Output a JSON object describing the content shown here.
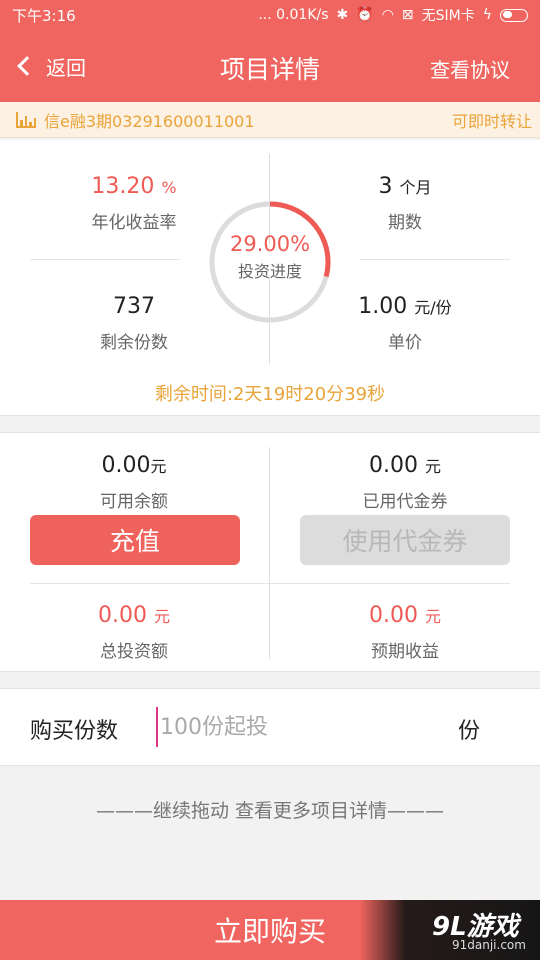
{
  "statusbar": {
    "time": "下午3:16",
    "network": "... 0.01K/s",
    "sim": "无SIM卡"
  },
  "nav": {
    "back_label": "返回",
    "title": "项目详情",
    "right_label": "查看协议"
  },
  "info": {
    "product_code": "信e融3期03291600011001",
    "transfer_status": "可即时转让"
  },
  "stats": {
    "rate_value": "13.20",
    "rate_unit": "%",
    "rate_label": "年化收益率",
    "term_value": "3",
    "term_unit": "个月",
    "term_label": "期数",
    "remaining_value": "737",
    "remaining_label": "剩余份数",
    "price_value": "1.00",
    "price_unit": "元/份",
    "price_label": "单价"
  },
  "progress": {
    "value": 0.29,
    "text": "29.00%",
    "label": "投资进度"
  },
  "countdown": "剩余时间:2天19时20分39秒",
  "account": {
    "balance_value": "0.00",
    "balance_unit": "元",
    "balance_label": "可用余额",
    "voucher_value": "0.00",
    "voucher_unit": "元",
    "voucher_label": "已用代金券",
    "recharge_button": "充值",
    "voucher_button": "使用代金券",
    "total_value": "0.00",
    "total_unit": "元",
    "total_label": "总投资额",
    "expected_value": "0.00",
    "expected_unit": "元",
    "expected_label": "预期收益"
  },
  "purchase": {
    "label": "购买份数",
    "placeholder": "100份起投",
    "unit": "份"
  },
  "more_hint": "———继续拖动 查看更多项目详情———",
  "buy_button": "立即购买",
  "watermark": {
    "logo": "9L游戏",
    "site": "91danji.com"
  },
  "colors": {
    "brand": "#f0655f",
    "accent_orange": "#e9a43a",
    "value_red": "#ef5a55"
  }
}
